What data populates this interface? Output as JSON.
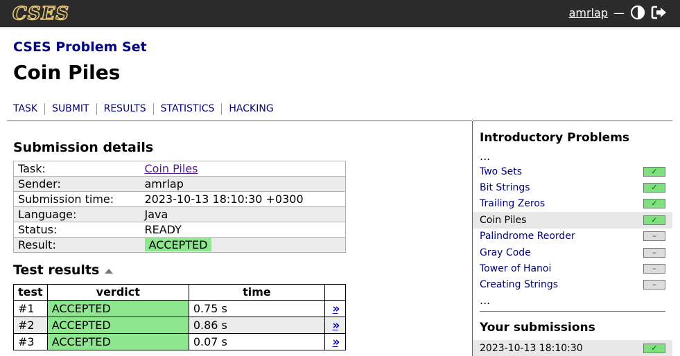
{
  "header": {
    "logo_text": "CSES",
    "username": "amrlap",
    "separator": "—",
    "theme_icon": "contrast-icon",
    "logout_icon": "logout-icon"
  },
  "problemset_title": "CSES Problem Set",
  "page_title": "Coin Piles",
  "nav": [
    "TASK",
    "SUBMIT",
    "RESULTS",
    "STATISTICS",
    "HACKING"
  ],
  "submission": {
    "heading": "Submission details",
    "rows": [
      {
        "label": "Task:",
        "value": "Coin Piles"
      },
      {
        "label": "Sender:",
        "value": "amrlap"
      },
      {
        "label": "Submission time:",
        "value": "2023-10-13 18:10:30 +0300"
      },
      {
        "label": "Language:",
        "value": "Java"
      },
      {
        "label": "Status:",
        "value": "READY"
      },
      {
        "label": "Result:",
        "value": "ACCEPTED"
      }
    ]
  },
  "tests": {
    "heading": "Test results",
    "columns": [
      "test",
      "verdict",
      "time"
    ],
    "rows": [
      {
        "test": "#1",
        "verdict": "ACCEPTED",
        "time": "0.75 s",
        "link": "»"
      },
      {
        "test": "#2",
        "verdict": "ACCEPTED",
        "time": "0.86 s",
        "link": "»"
      },
      {
        "test": "#3",
        "verdict": "ACCEPTED",
        "time": "0.07 s",
        "link": "»"
      }
    ]
  },
  "sidebar": {
    "section_title": "Introductory Problems",
    "ellipsis": "...",
    "items": [
      {
        "label": "Two Sets",
        "status": "✓"
      },
      {
        "label": "Bit Strings",
        "status": "✓"
      },
      {
        "label": "Trailing Zeros",
        "status": "✓"
      },
      {
        "label": "Coin Piles",
        "status": "✓"
      },
      {
        "label": "Palindrome Reorder",
        "status": "–"
      },
      {
        "label": "Gray Code",
        "status": "–"
      },
      {
        "label": "Tower of Hanoi",
        "status": "–"
      },
      {
        "label": "Creating Strings",
        "status": "–"
      }
    ],
    "submissions_title": "Your submissions",
    "submissions": [
      {
        "time": "2023-10-13 18:10:30",
        "status": "✓"
      }
    ]
  },
  "colors": {
    "accent": "#000080",
    "accepted": "#8ee68e",
    "header_bg": "#2b2b2b"
  }
}
